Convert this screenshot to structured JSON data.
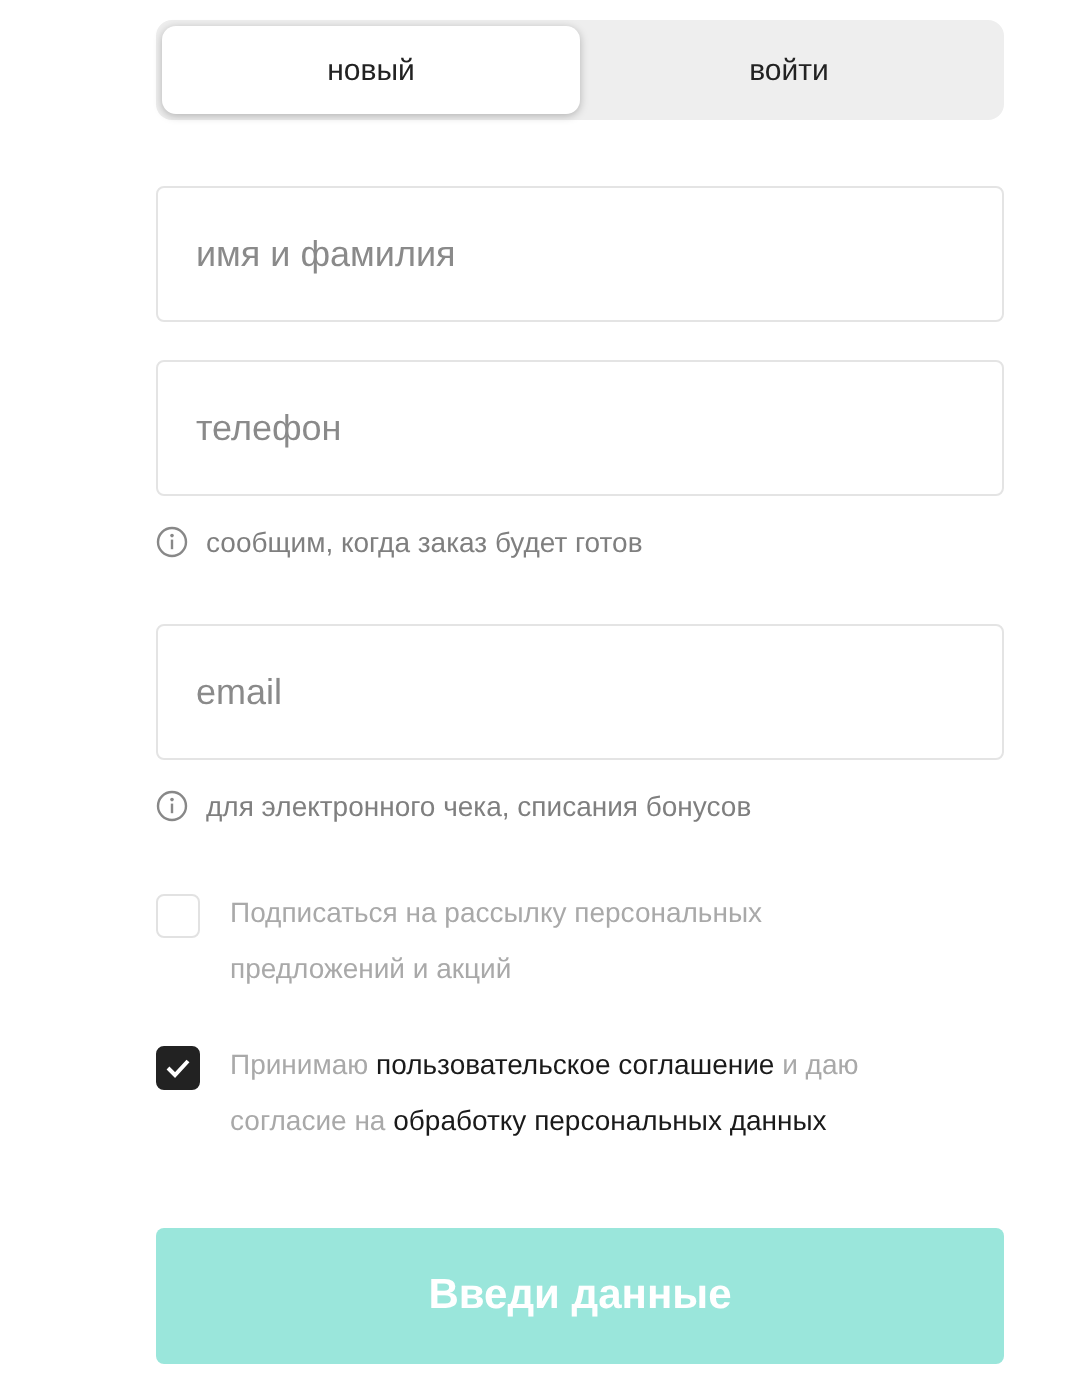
{
  "tabs": [
    {
      "label": "новый",
      "selected": true
    },
    {
      "label": "войти",
      "selected": false
    }
  ],
  "fields": [
    {
      "placeholder": "имя и фамилия"
    },
    {
      "placeholder": "телефон",
      "hint": "сообщим, когда заказ будет готов"
    },
    {
      "placeholder": "email",
      "hint": "для электронного чека, списания бонусов"
    }
  ],
  "checkboxes": [
    {
      "checked": false,
      "parts": [
        {
          "kind": "plain",
          "text": "Подписаться на рассылку персональных предложений и акций"
        }
      ]
    },
    {
      "checked": true,
      "parts": [
        {
          "kind": "plain",
          "text": "Принимаю "
        },
        {
          "kind": "link",
          "text": "пользовательское соглашение"
        },
        {
          "kind": "plain",
          "text": " и даю согласие на "
        },
        {
          "kind": "link",
          "text": "обработку персональных данных"
        }
      ]
    }
  ],
  "submit": {
    "label": "Введи данные",
    "disabled": true
  }
}
